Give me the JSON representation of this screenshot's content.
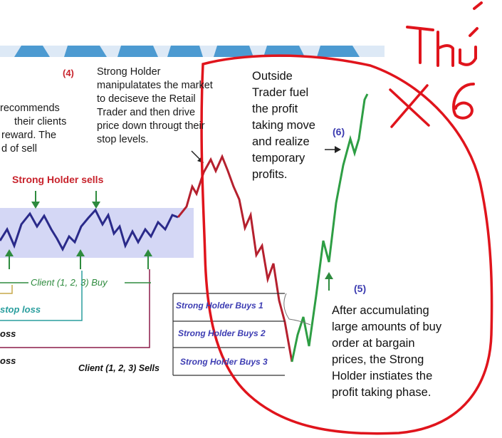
{
  "labels": {
    "num4": "(4)",
    "num5": "(5)",
    "num6": "(6)",
    "strong_holder_sells": "Strong Holder sells",
    "client_buy": "Client (1, 2, 3) Buy",
    "client_sells": "Client (1, 2, 3) Sells",
    "stop_loss": "stop loss",
    "loss_a": "oss",
    "loss_b": "oss",
    "sh_buys_1": "Strong Holder Buys 1",
    "sh_buys_2": "Strong Holder Buys 2",
    "sh_buys_3": "Strong Holder Buys 3"
  },
  "left_text": [
    "recommends",
    "their clients",
    "reward. The",
    "d of sell"
  ],
  "strong_holder_text": [
    "Strong Holder",
    "manipulatates the market",
    "to deciseve the Retail",
    "Trader and then drive",
    "price down througt their",
    "stop levels."
  ],
  "outside_trader_text": [
    "Outside",
    "Trader fuel",
    "the profit",
    "taking move",
    "and realize",
    "temporary",
    "profits."
  ],
  "accumulating_text": [
    "After accumulating",
    "large amounts of buy",
    "order at bargain",
    "prices, the Strong",
    "Holder instiates the",
    "profit taking phase."
  ],
  "handwriting": {
    "line1": "Thứ",
    "line2": "6"
  },
  "colors": {
    "down_trend": "#b5202e",
    "up_trend": "#2e9e44",
    "range": "#2a2a8a",
    "band": "#c9cdf2",
    "annotation": "#e0141c",
    "green_arrow": "#2e8b3e",
    "banner": "#1b7fc4"
  }
}
